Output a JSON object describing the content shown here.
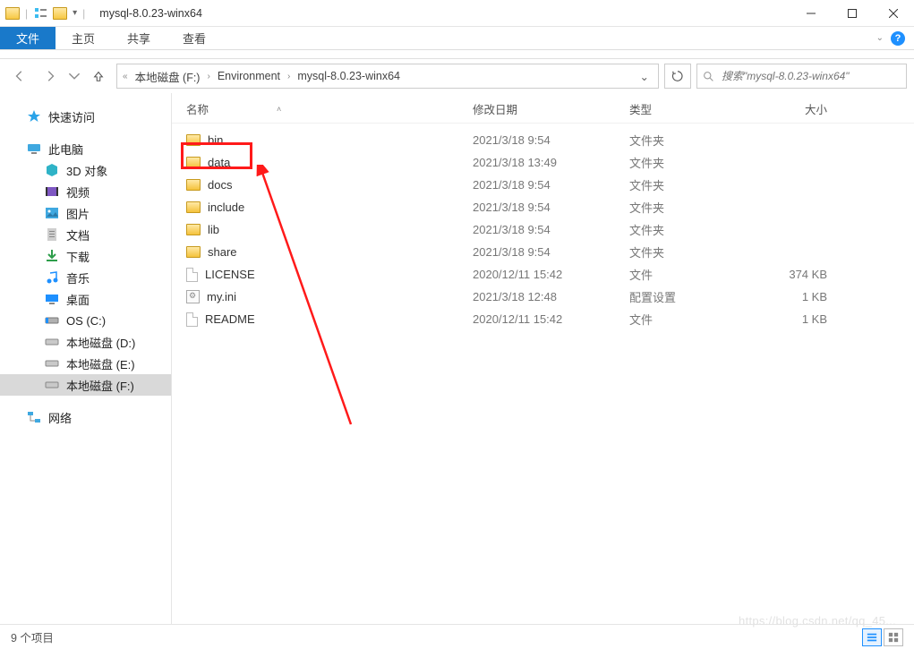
{
  "window": {
    "title": "mysql-8.0.23-winx64"
  },
  "ribbon": {
    "file_tab": "文件",
    "tabs": [
      "主页",
      "共享",
      "查看"
    ]
  },
  "nav": {
    "crumbs": [
      "本地磁盘 (F:)",
      "Environment",
      "mysql-8.0.23-winx64"
    ]
  },
  "search": {
    "placeholder": "搜索\"mysql-8.0.23-winx64\""
  },
  "sidebar": {
    "quick_access": "快速访问",
    "this_pc": "此电脑",
    "pc_items": [
      {
        "label": "3D 对象"
      },
      {
        "label": "视频"
      },
      {
        "label": "图片"
      },
      {
        "label": "文档"
      },
      {
        "label": "下载"
      },
      {
        "label": "音乐"
      },
      {
        "label": "桌面"
      },
      {
        "label": "OS (C:)"
      },
      {
        "label": "本地磁盘 (D:)"
      },
      {
        "label": "本地磁盘 (E:)"
      },
      {
        "label": "本地磁盘 (F:)"
      }
    ],
    "network": "网络"
  },
  "columns": {
    "name": "名称",
    "date": "修改日期",
    "type": "类型",
    "size": "大小"
  },
  "files": [
    {
      "name": "bin",
      "date": "2021/3/18 9:54",
      "type": "文件夹",
      "size": "",
      "icon": "folder"
    },
    {
      "name": "data",
      "date": "2021/3/18 13:49",
      "type": "文件夹",
      "size": "",
      "icon": "folder",
      "highlighted": true
    },
    {
      "name": "docs",
      "date": "2021/3/18 9:54",
      "type": "文件夹",
      "size": "",
      "icon": "folder"
    },
    {
      "name": "include",
      "date": "2021/3/18 9:54",
      "type": "文件夹",
      "size": "",
      "icon": "folder"
    },
    {
      "name": "lib",
      "date": "2021/3/18 9:54",
      "type": "文件夹",
      "size": "",
      "icon": "folder"
    },
    {
      "name": "share",
      "date": "2021/3/18 9:54",
      "type": "文件夹",
      "size": "",
      "icon": "folder"
    },
    {
      "name": "LICENSE",
      "date": "2020/12/11 15:42",
      "type": "文件",
      "size": "374 KB",
      "icon": "file"
    },
    {
      "name": "my.ini",
      "date": "2021/3/18 12:48",
      "type": "配置设置",
      "size": "1 KB",
      "icon": "ini"
    },
    {
      "name": "README",
      "date": "2020/12/11 15:42",
      "type": "文件",
      "size": "1 KB",
      "icon": "file"
    }
  ],
  "statusbar": {
    "count_text": "9 个项目"
  },
  "watermark": "https://blog.csdn.net/qq_45..."
}
